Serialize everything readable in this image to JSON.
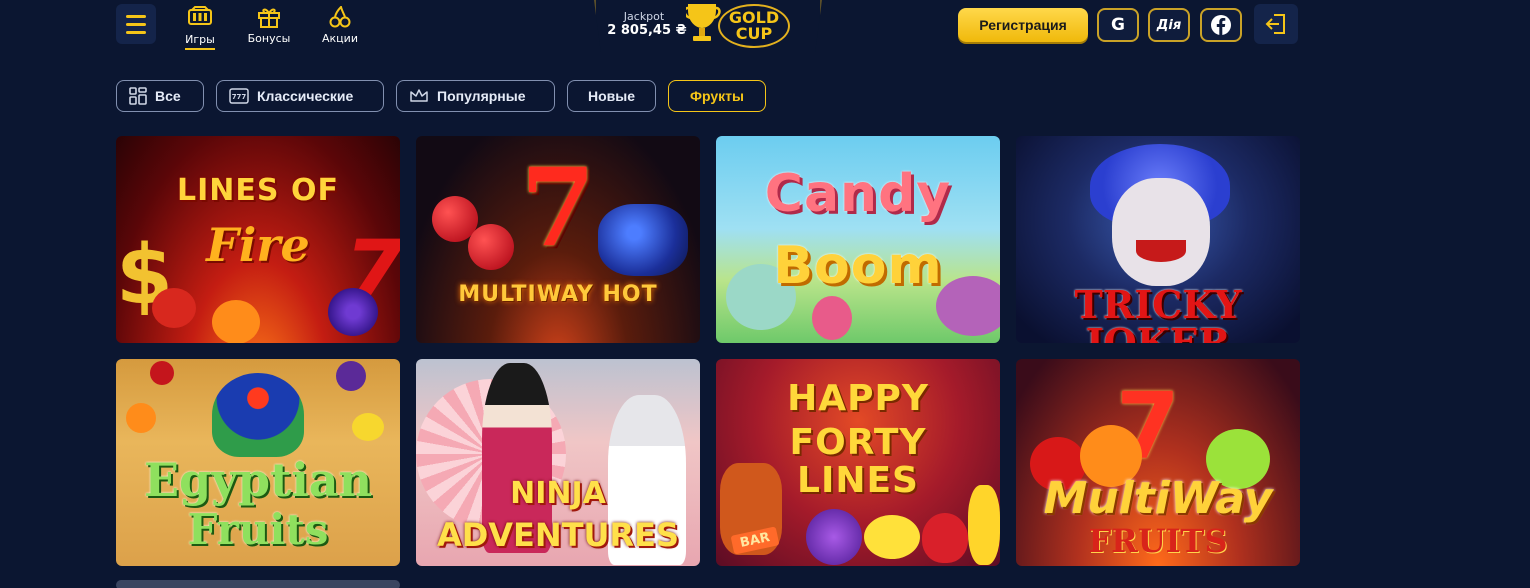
{
  "header": {
    "nav": [
      {
        "label": "Игры",
        "icon": "games-icon",
        "active": true
      },
      {
        "label": "Бонусы",
        "icon": "gift-icon",
        "active": false
      },
      {
        "label": "Акции",
        "icon": "cherry-icon",
        "active": false
      }
    ],
    "jackpot": {
      "label": "Jackpot",
      "value": "2 805,45 ₴"
    },
    "logo": {
      "line1": "GOLD",
      "line2": "CUP"
    },
    "register_label": "Регистрация",
    "google_label": "G",
    "diya_label": "Дія",
    "facebook_icon": "facebook-icon",
    "logout_icon": "login-icon"
  },
  "filters": [
    {
      "label": "Все",
      "icon": "grid-icon",
      "active": false
    },
    {
      "label": "Классические",
      "icon": "slot-777-icon",
      "active": false
    },
    {
      "label": "Популярные",
      "icon": "crown-icon",
      "active": false
    },
    {
      "label": "Новые",
      "icon": "",
      "active": false
    },
    {
      "label": "Фрукты",
      "icon": "",
      "active": true
    }
  ],
  "games": [
    {
      "line1": "LINES OF",
      "line2": "Fire"
    },
    {
      "line1": "7",
      "line2": "MULTIWAY HOT"
    },
    {
      "line1": "Candy",
      "line2": "Boom"
    },
    {
      "line1": "TRICKY",
      "line2": "JOKER"
    },
    {
      "line1": "Egyptian",
      "line2": "Fruits"
    },
    {
      "line1": "NINJA",
      "line2": "ADVENTURES"
    },
    {
      "line1": "HAPPY FORTY",
      "line2": "LINES"
    },
    {
      "line1": "MultiWay",
      "line2": "FRUITS"
    }
  ],
  "colors": {
    "background": "#0b1631",
    "accent": "#f5c518",
    "filter_border": "#8290b0"
  }
}
